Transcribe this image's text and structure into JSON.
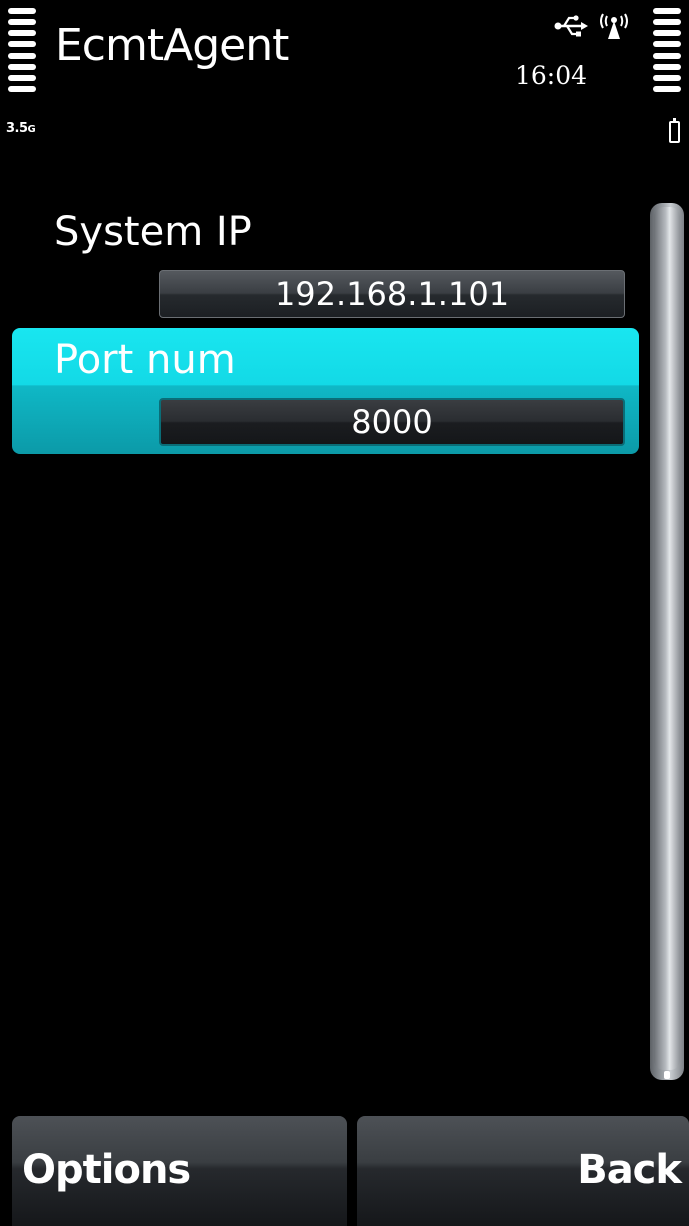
{
  "status_bar": {
    "app_title": "EcmtAgent",
    "time": "16:04",
    "network_type_main": "3.5",
    "network_type_suffix": "G",
    "icons": {
      "signal": "signal-strength-icon",
      "usb": "usb-icon",
      "antenna": "packet-data-antenna-icon",
      "battery": "battery-level-icon",
      "battery_bars": "battery-bars-icon"
    }
  },
  "settings": [
    {
      "label": "System IP",
      "value": "192.168.1.101",
      "selected": false
    },
    {
      "label": "Port num",
      "value": "8000",
      "selected": true
    }
  ],
  "softkeys": {
    "left_label": "Options",
    "right_label": "Back"
  },
  "colors": {
    "background": "#000000",
    "highlight": "#13d9e6",
    "text": "#ffffff"
  }
}
